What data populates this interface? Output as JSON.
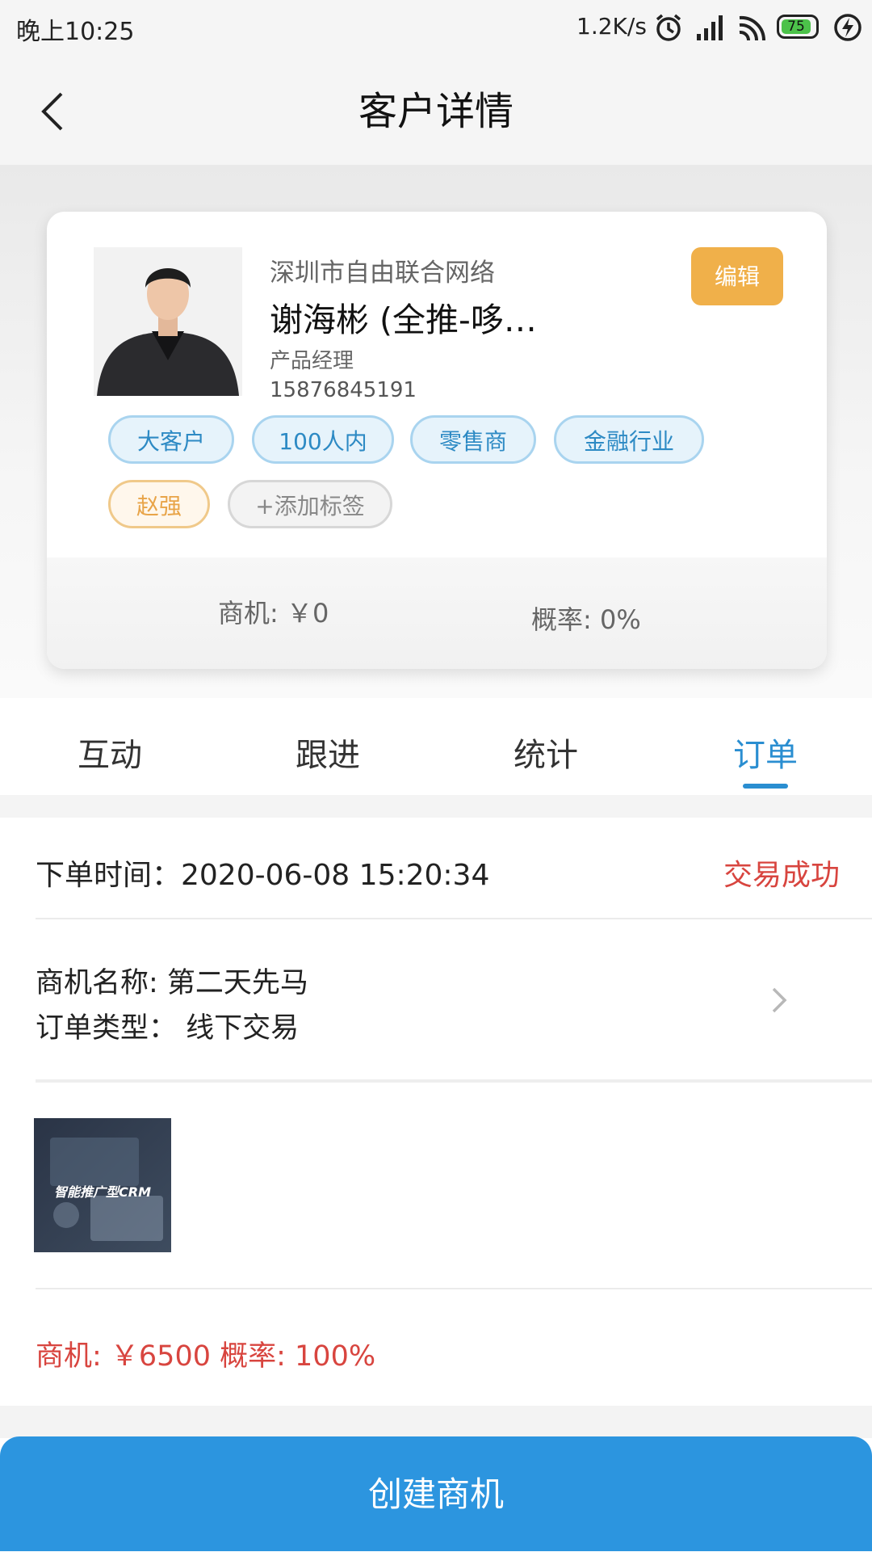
{
  "status_bar": {
    "time": "晚上10:25",
    "net_speed": "1.2K/s",
    "battery": "75",
    "icons": [
      "alarm-icon",
      "signal-icon",
      "wifi-icon",
      "battery-icon",
      "charging-icon"
    ]
  },
  "nav": {
    "title": "客户详情",
    "back_icon": "chevron-left-icon"
  },
  "customer": {
    "company": "深圳市自由联合网络",
    "name": "谢海彬 (全推-哆…",
    "position": "产品经理",
    "phone": "15876845191",
    "edit_label": "编辑",
    "tags": [
      "大客户",
      "100人内",
      "零售商",
      "金融行业"
    ],
    "owner_tag": "赵强",
    "add_tag_label": "+添加标签",
    "opportunity": "商机: ￥0",
    "probability": "概率: 0%"
  },
  "tabs": [
    {
      "label": "互动"
    },
    {
      "label": "跟进"
    },
    {
      "label": "统计"
    },
    {
      "label": "订单",
      "active": true
    }
  ],
  "order": {
    "time": "下单时间：2020-06-08 15:20:34",
    "status": "交易成功",
    "biz_name": "商机名称: 第二天先马",
    "order_type": "订单类型：  线下交易",
    "thumb_text": "智能推广型CRM",
    "summary": "商机: ￥6500 概率: 100%"
  },
  "footer": {
    "create_label": "创建商机"
  },
  "colors": {
    "accent": "#2c95df",
    "edit": "#f0b04a",
    "success_red": "#d8453f"
  }
}
